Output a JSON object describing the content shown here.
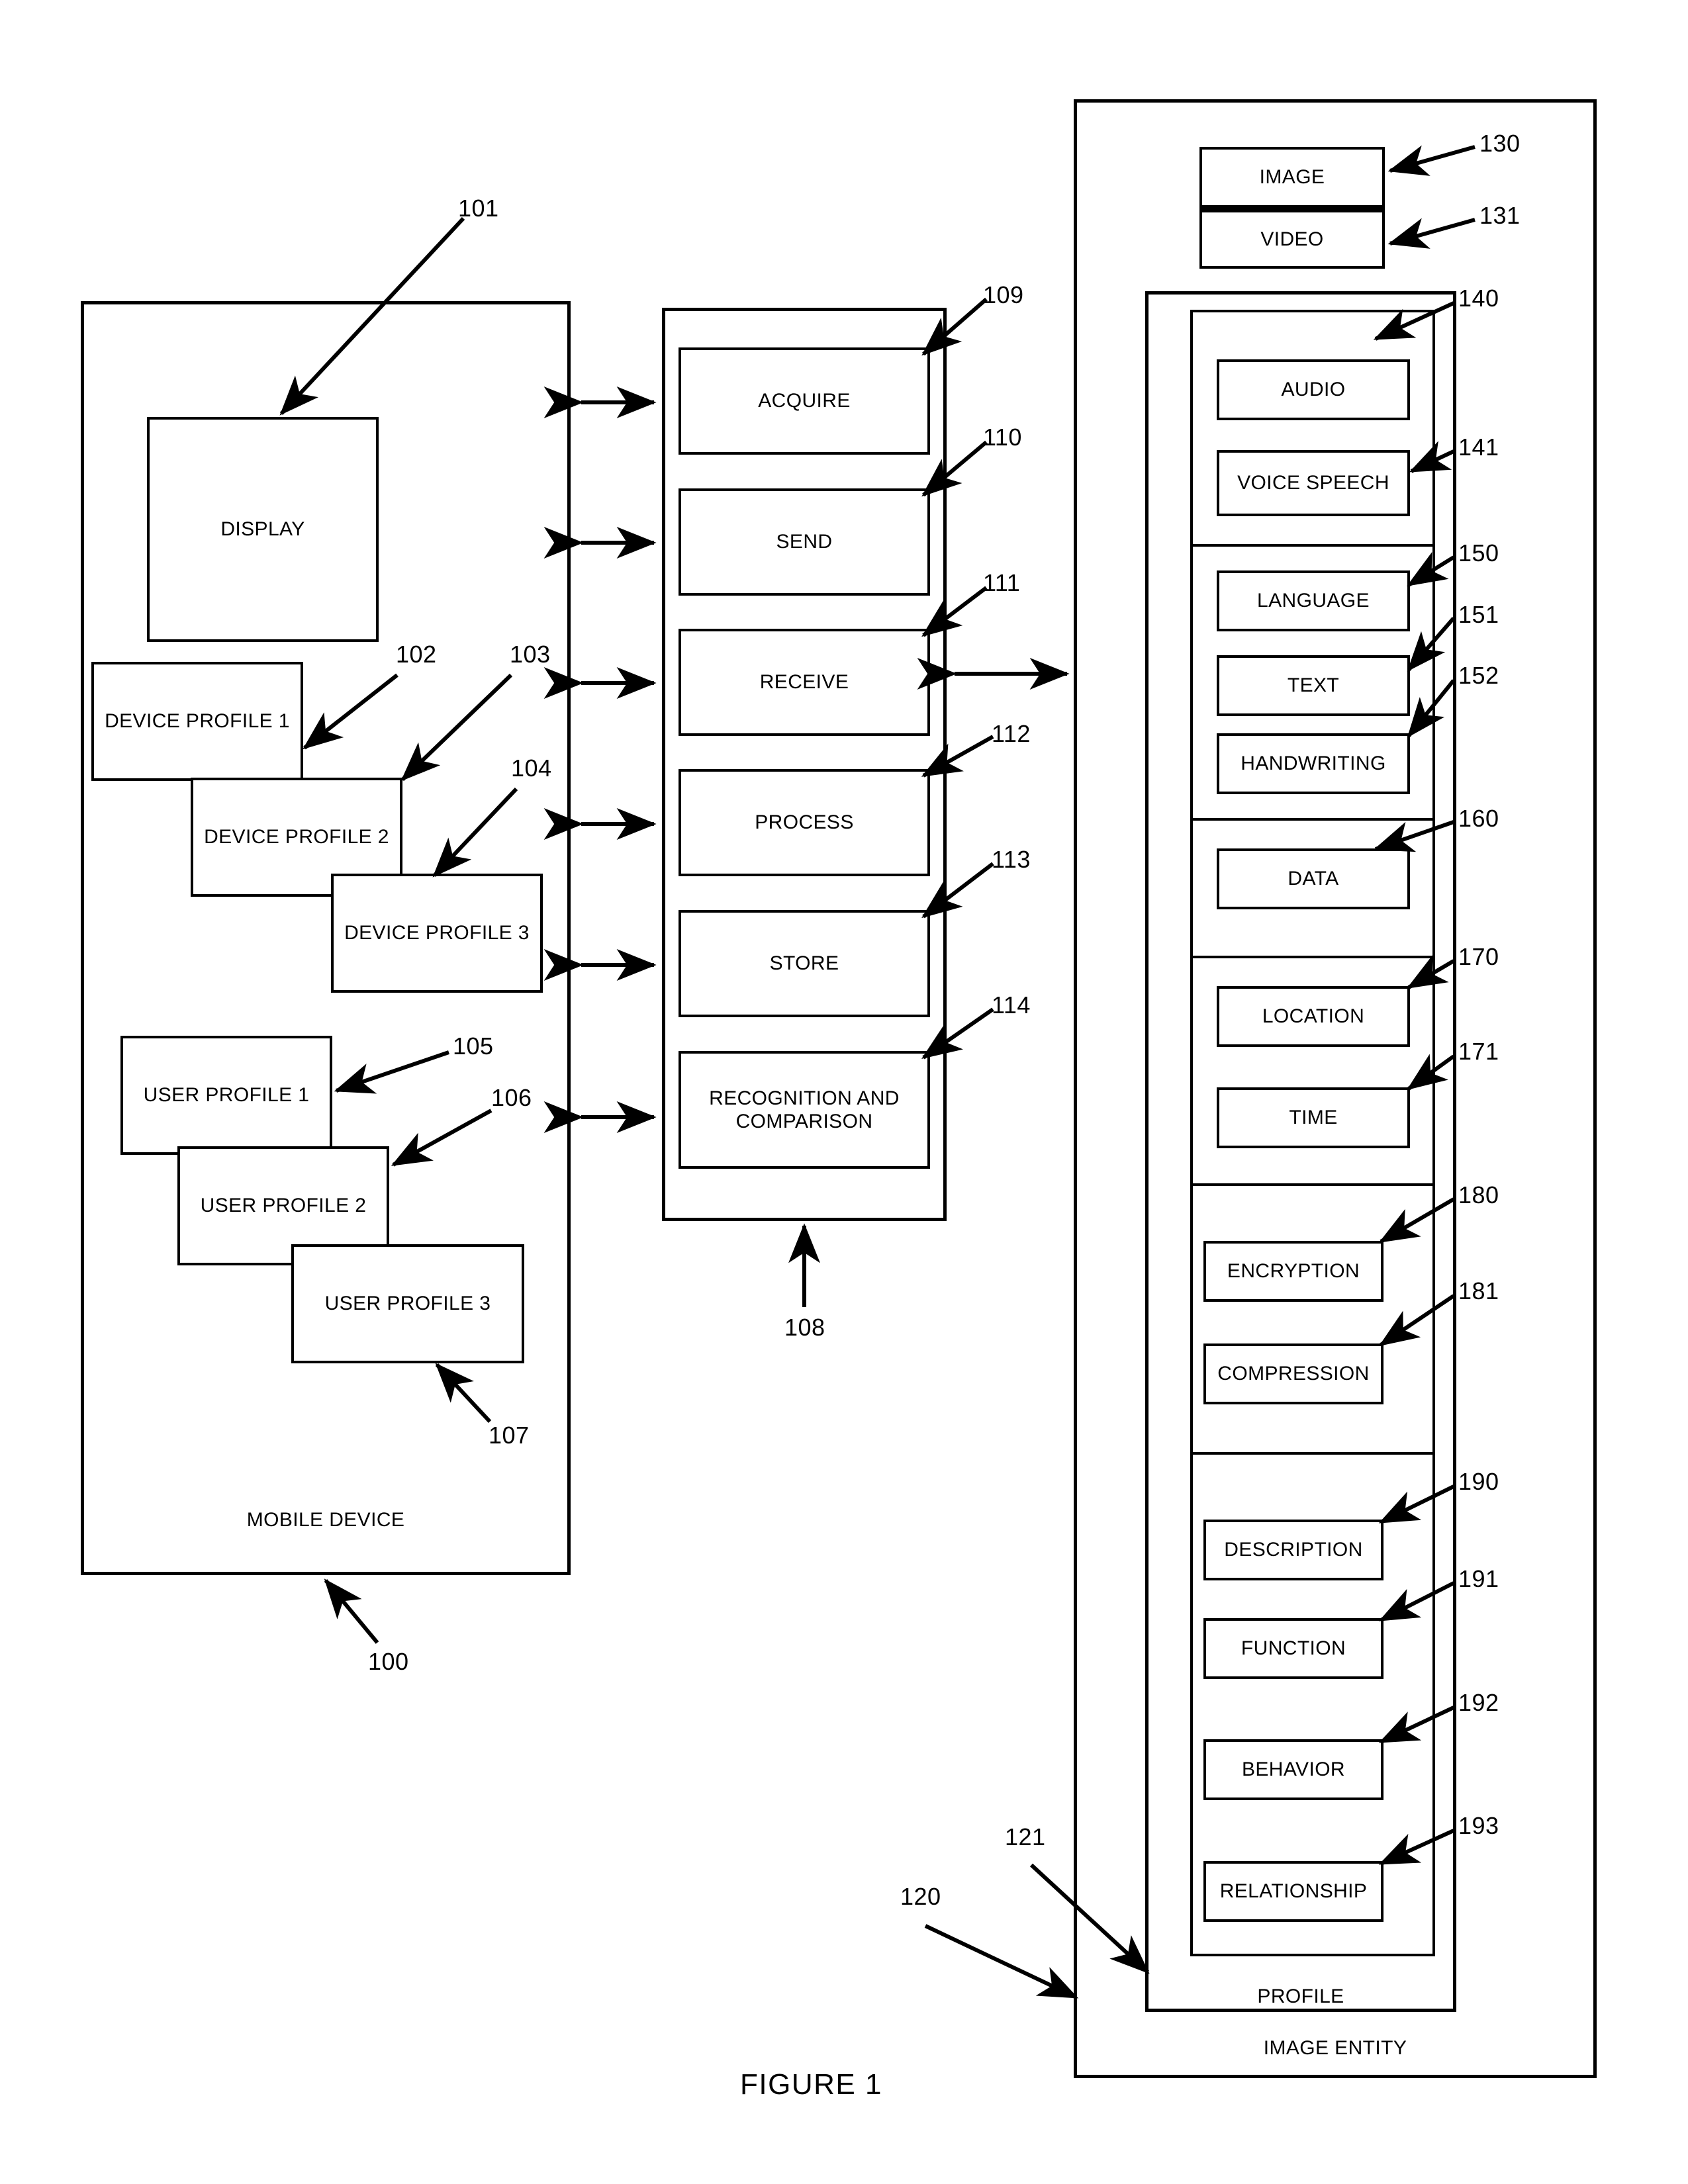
{
  "figure": {
    "label": "FIGURE 1"
  },
  "mobile_device": {
    "caption": "MOBILE DEVICE",
    "ref": "100",
    "display": {
      "label": "DISPLAY",
      "ref": "101"
    },
    "device_profiles": [
      {
        "label": "DEVICE PROFILE 1",
        "ref": "102"
      },
      {
        "label": "DEVICE PROFILE 2",
        "ref": "103"
      },
      {
        "label": "DEVICE PROFILE 3",
        "ref": "104"
      }
    ],
    "user_profiles": [
      {
        "label": "USER PROFILE 1",
        "ref": "105"
      },
      {
        "label": "USER PROFILE 2",
        "ref": "106"
      },
      {
        "label": "USER PROFILE 3",
        "ref": "107"
      }
    ]
  },
  "operations": {
    "ref": "108",
    "items": [
      {
        "label": "ACQUIRE",
        "ref": "109"
      },
      {
        "label": "SEND",
        "ref": "110"
      },
      {
        "label": "RECEIVE",
        "ref": "111"
      },
      {
        "label": "PROCESS",
        "ref": "112"
      },
      {
        "label": "STORE",
        "ref": "113"
      },
      {
        "label": "RECOGNITION AND COMPARISON",
        "ref": "114"
      }
    ]
  },
  "image_entity": {
    "caption": "IMAGE ENTITY",
    "ref": "120",
    "media": [
      {
        "label": "IMAGE",
        "ref": "130"
      },
      {
        "label": "VIDEO",
        "ref": "131"
      }
    ],
    "profile": {
      "caption": "PROFILE",
      "ref": "121",
      "groups": [
        {
          "items": [
            {
              "label": "AUDIO",
              "ref": "140"
            },
            {
              "label": "VOICE SPEECH",
              "ref": "141"
            }
          ]
        },
        {
          "items": [
            {
              "label": "LANGUAGE",
              "ref": "150"
            },
            {
              "label": "TEXT",
              "ref": "151"
            },
            {
              "label": "HANDWRITING",
              "ref": "152"
            }
          ]
        },
        {
          "items": [
            {
              "label": "DATA",
              "ref": "160"
            }
          ]
        },
        {
          "items": [
            {
              "label": "LOCATION",
              "ref": "170"
            },
            {
              "label": "TIME",
              "ref": "171"
            }
          ]
        },
        {
          "items": [
            {
              "label": "ENCRYPTION",
              "ref": "180"
            },
            {
              "label": "COMPRESSION",
              "ref": "181"
            }
          ]
        },
        {
          "items": [
            {
              "label": "DESCRIPTION",
              "ref": "190"
            },
            {
              "label": "FUNCTION",
              "ref": "191"
            },
            {
              "label": "BEHAVIOR",
              "ref": "192"
            },
            {
              "label": "RELATIONSHIP",
              "ref": "193"
            }
          ]
        }
      ]
    }
  },
  "colors": {
    "ink": "#000000",
    "paper": "#ffffff"
  }
}
